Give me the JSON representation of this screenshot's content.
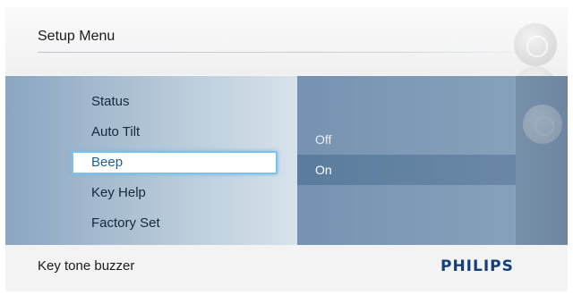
{
  "header": {
    "title": "Setup Menu"
  },
  "menu": {
    "items": [
      {
        "label": "Status"
      },
      {
        "label": "Auto Tilt"
      },
      {
        "label": "Beep",
        "selected": true
      },
      {
        "label": "Key Help"
      },
      {
        "label": "Factory Set"
      }
    ]
  },
  "submenu": {
    "options": [
      {
        "label": "Off"
      },
      {
        "label": "On",
        "selected": true
      }
    ]
  },
  "footer": {
    "description": "Key tone buzzer",
    "brand": "PHILIPS"
  },
  "colors": {
    "panel": "#7f9ab4",
    "selection_highlight": "#7ec1ea",
    "brand": "#143f7a"
  }
}
